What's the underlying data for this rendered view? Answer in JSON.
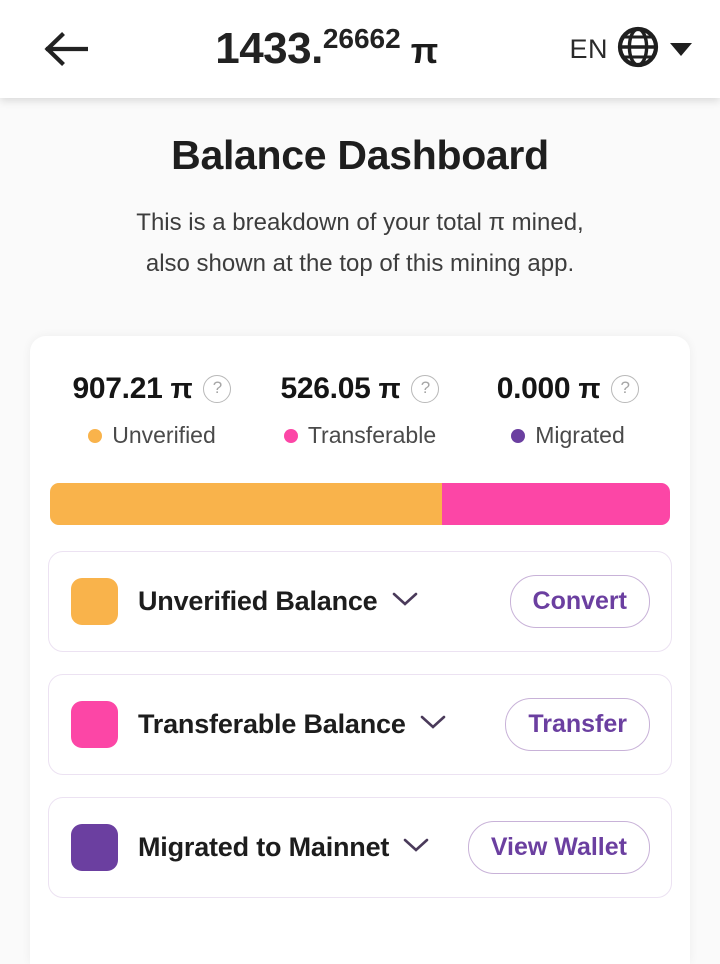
{
  "header": {
    "back_icon": "arrow-left-icon",
    "balance_integer": "1433.",
    "balance_fraction": "26662",
    "balance_unit": "π",
    "language_code": "EN",
    "globe_icon": "globe-icon",
    "caret_icon": "chevron-down-icon"
  },
  "page": {
    "title": "Balance Dashboard",
    "subtitle_line1": "This is a breakdown of your total π mined,",
    "subtitle_line2": "also shown at the top of this mining app."
  },
  "stats": [
    {
      "amount": "907.21",
      "unit": "π",
      "legend": "Unverified",
      "color": "#f9b34b",
      "help": "?"
    },
    {
      "amount": "526.05",
      "unit": "π",
      "legend": "Transferable",
      "color": "#fc46a6",
      "help": "?"
    },
    {
      "amount": "0.000",
      "unit": "π",
      "legend": "Migrated",
      "color": "#6b3fa0",
      "help": "?"
    }
  ],
  "progress": {
    "segments": [
      {
        "name": "unverified",
        "percent": 63.3,
        "color": "#f9b34b"
      },
      {
        "name": "transferable",
        "percent": 36.7,
        "color": "#fc46a6"
      }
    ]
  },
  "balance_cards": [
    {
      "label": "Unverified Balance",
      "color": "#f9b34b",
      "action": "Convert",
      "chevron": "chevron-down-icon"
    },
    {
      "label": "Transferable Balance",
      "color": "#fc46a6",
      "action": "Transfer",
      "chevron": "chevron-down-icon"
    },
    {
      "label": "Migrated to Mainnet",
      "color": "#6b3fa0",
      "action": "View Wallet",
      "chevron": "chevron-down-icon"
    }
  ],
  "theme": {
    "accent_purple": "#6b3fa0",
    "orange": "#f9b34b",
    "pink": "#fc46a6",
    "card_border": "#ece2f2",
    "page_bg": "#fafafa"
  }
}
